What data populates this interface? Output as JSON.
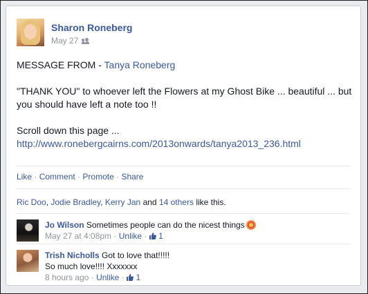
{
  "post": {
    "author": "Sharon Roneberg",
    "date": "May 27",
    "audience_icon": "friends-icon",
    "message_prefix": "MESSAGE FROM - ",
    "message_from_name": "Tanya Roneberg",
    "body_line1": "\"THANK YOU\" to whoever left the Flowers at my Ghost Bike ... beautiful ... but",
    "body_line2": "you should have left a note too !!",
    "scroll_text": "Scroll down this page ...",
    "url": "http://www.ronebergcairns.com/2013onwards/tanya2013_236.html"
  },
  "actions": {
    "like": "Like",
    "comment": "Comment",
    "promote": "Promote",
    "share": "Share",
    "separator": "·"
  },
  "likes": {
    "name1": "Ric Doo",
    "name2": "Jodie Bradley",
    "name3": "Kerry Jan",
    "and_text": "and",
    "others": "14 others",
    "suffix": "like this."
  },
  "comments": [
    {
      "name": "Jo Wilson",
      "text": "Sometimes people can do the nicest things",
      "emoji_icon": "flower-icon",
      "time": "May 27 at 4:08pm",
      "unlike": "Unlike",
      "like_count": "1"
    },
    {
      "name": "Trish Nicholls",
      "text_line1": "Got to love that!!!!!",
      "text_line2": "So much love!!!! Xxxxxxx",
      "time": "8 hours ago",
      "unlike": "Unlike",
      "like_count": "1"
    }
  ],
  "colors": {
    "link_blue": "#3b5998",
    "meta_gray": "#90949c",
    "background": "#e9ebee"
  }
}
